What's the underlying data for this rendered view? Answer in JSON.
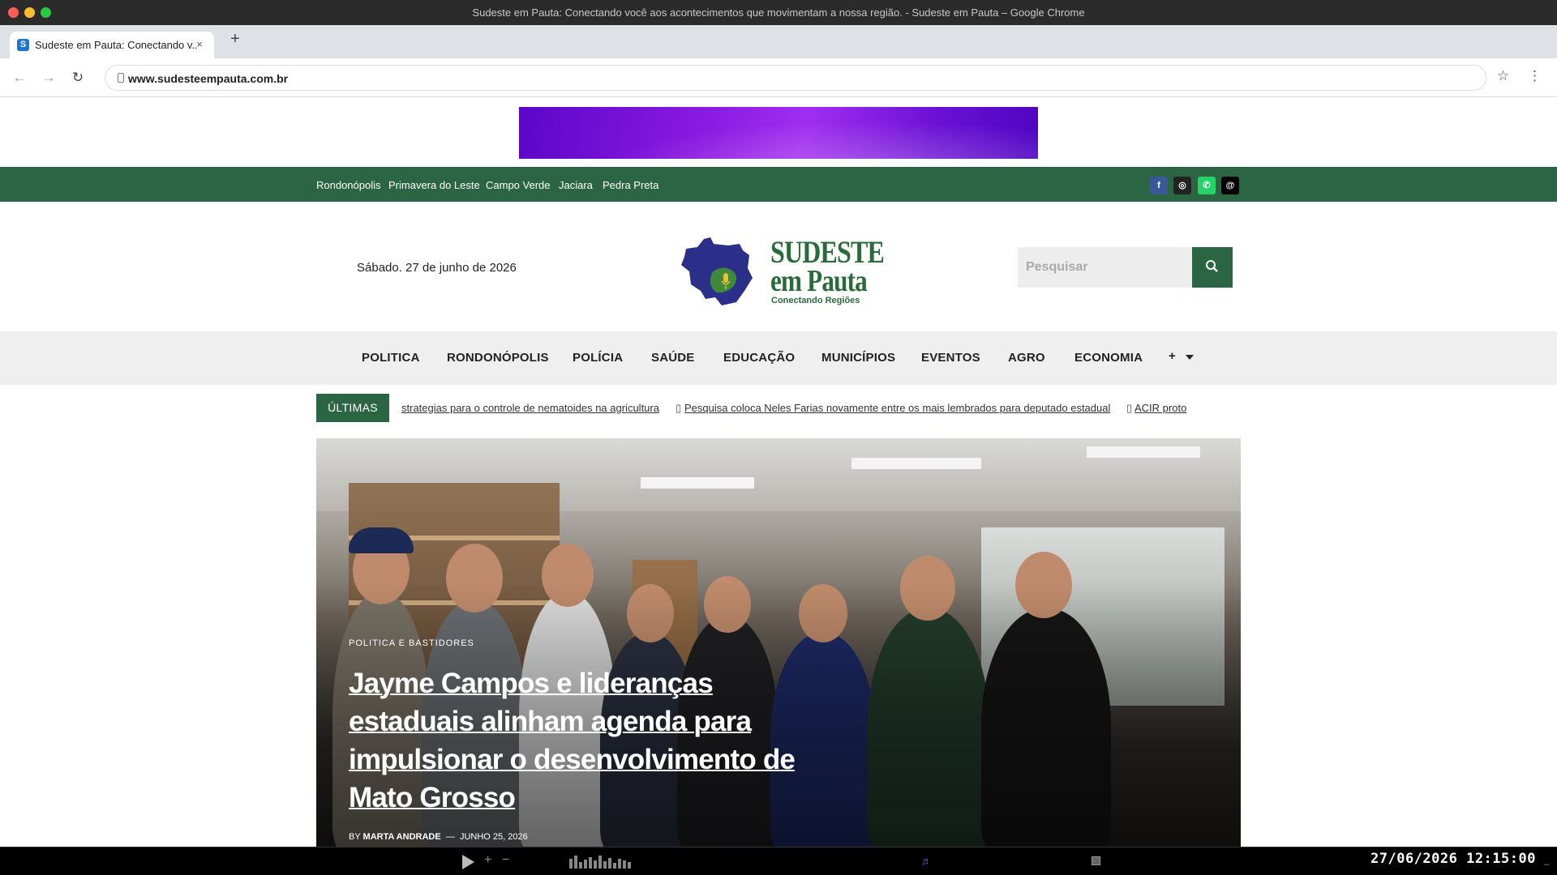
{
  "window": {
    "title": "Sudeste em Pauta: Conectando você aos acontecimentos que movimentam a nossa região. - Sudeste em Pauta – Google Chrome"
  },
  "tab": {
    "title": "Sudeste em Pauta: Conectando v...",
    "favicon": "S",
    "close": "×",
    "new_tab": "+"
  },
  "toolbar": {
    "url": "www.sudesteempauta.com.br",
    "back": "←",
    "forward": "→",
    "reload": "↻",
    "star": "☆",
    "menu": "⋮"
  },
  "topbar": {
    "cities": [
      "Rondonópolis",
      "Primavera do Leste",
      "Campo Verde",
      "Jaciara",
      "Pedra Preta"
    ],
    "social": [
      {
        "name": "facebook-icon",
        "glyph": "f"
      },
      {
        "name": "instagram-icon",
        "glyph": "◎"
      },
      {
        "name": "whatsapp-icon",
        "glyph": "✆"
      },
      {
        "name": "threads-icon",
        "glyph": "@"
      }
    ],
    "color": "#2c6544"
  },
  "header": {
    "date": "Sábado. 27 de junho de 2026",
    "logo": {
      "line1": "SUDESTE",
      "line2": "em Pauta",
      "tagline": "Conectando Regiões"
    },
    "search": {
      "placeholder": "Pesquisar",
      "button_icon": "search-icon"
    }
  },
  "nav": {
    "items": [
      "POLITICA",
      "RONDONÓPOLIS",
      "POLÍCIA",
      "SAÚDE",
      "EDUCAÇÃO",
      "MUNICÍPIOS",
      "EVENTOS",
      "AGRO",
      "ECONOMIA"
    ],
    "more": "+"
  },
  "ticker": {
    "label": "ÚLTIMAS",
    "items": [
      "strategias para o controle de nematoides na agricultura",
      "Pesquisa coloca Neles Farias novamente entre os mais lembrados para deputado estadual",
      "ACIR proto"
    ]
  },
  "hero": {
    "category": "POLITICA E BASTIDORES",
    "title": "Jayme Campos e lideranças estaduais alinham agenda para impulsionar o desenvolvimento de Mato Grosso",
    "by": "BY",
    "author": "MARTA ANDRADE",
    "separator": "—",
    "date": "JUNHO 25, 2026"
  },
  "player": {
    "plus": "+",
    "minus": "−",
    "note": "♬",
    "clock": "27/06/2026 12:15:00",
    "tail": "_"
  }
}
